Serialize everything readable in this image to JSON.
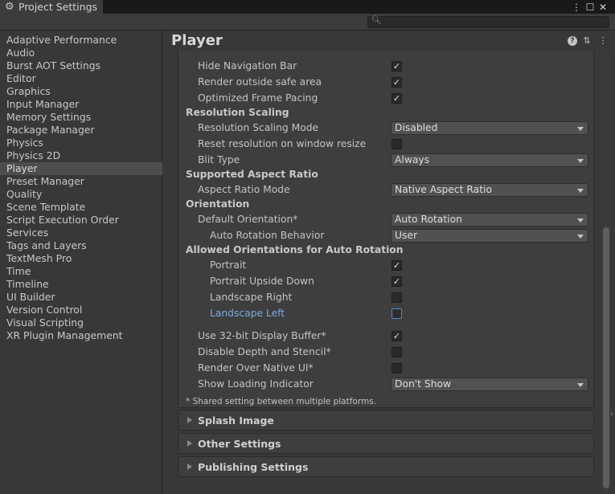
{
  "window": {
    "tab_title": "Project Settings",
    "controls": [
      "⋮",
      "☐",
      "✕"
    ]
  },
  "search": {
    "placeholder": "",
    "icon": "search-icon"
  },
  "sidebar": {
    "items": [
      {
        "label": "Adaptive Performance"
      },
      {
        "label": "Audio"
      },
      {
        "label": "Burst AOT Settings"
      },
      {
        "label": "Editor"
      },
      {
        "label": "Graphics"
      },
      {
        "label": "Input Manager"
      },
      {
        "label": "Memory Settings"
      },
      {
        "label": "Package Manager"
      },
      {
        "label": "Physics"
      },
      {
        "label": "Physics 2D"
      },
      {
        "label": "Player",
        "selected": true
      },
      {
        "label": "Preset Manager"
      },
      {
        "label": "Quality"
      },
      {
        "label": "Scene Template"
      },
      {
        "label": "Script Execution Order"
      },
      {
        "label": "Services"
      },
      {
        "label": "Tags and Layers"
      },
      {
        "label": "TextMesh Pro"
      },
      {
        "label": "Time"
      },
      {
        "label": "Timeline"
      },
      {
        "label": "UI Builder"
      },
      {
        "label": "Version Control"
      },
      {
        "label": "Visual Scripting"
      },
      {
        "label": "XR Plugin Management"
      }
    ]
  },
  "main": {
    "title": "Player",
    "header_icons": [
      "help-icon",
      "sliders-icon",
      "more-icon"
    ],
    "rows": [
      {
        "type": "checkbox",
        "label": "Hide Navigation Bar",
        "checked": true
      },
      {
        "type": "checkbox",
        "label": "Render outside safe area",
        "checked": true
      },
      {
        "type": "checkbox",
        "label": "Optimized Frame Pacing",
        "checked": true
      },
      {
        "type": "section",
        "label": "Resolution Scaling"
      },
      {
        "type": "dropdown",
        "label": "Resolution Scaling Mode",
        "value": "Disabled"
      },
      {
        "type": "checkbox",
        "label": "Reset resolution on window resize",
        "checked": false
      },
      {
        "type": "dropdown",
        "label": "Blit Type",
        "value": "Always"
      },
      {
        "type": "section",
        "label": "Supported Aspect Ratio"
      },
      {
        "type": "dropdown",
        "label": "Aspect Ratio Mode",
        "value": "Native Aspect Ratio"
      },
      {
        "type": "section",
        "label": "Orientation"
      },
      {
        "type": "dropdown",
        "label": "Default Orientation*",
        "value": "Auto Rotation"
      },
      {
        "type": "dropdown",
        "label": "Auto Rotation Behavior",
        "value": "User",
        "indent": 2
      },
      {
        "type": "section",
        "label": "Allowed Orientations for Auto Rotation"
      },
      {
        "type": "checkbox",
        "label": "Portrait",
        "checked": true,
        "indent": 2
      },
      {
        "type": "checkbox",
        "label": "Portrait Upside Down",
        "checked": true,
        "indent": 2
      },
      {
        "type": "checkbox",
        "label": "Landscape Right",
        "checked": false,
        "indent": 2
      },
      {
        "type": "checkbox",
        "label": "Landscape Left",
        "checked": false,
        "indent": 2,
        "focused": true
      },
      {
        "type": "checkbox",
        "label": "Use 32-bit Display Buffer*",
        "checked": true
      },
      {
        "type": "checkbox",
        "label": "Disable Depth and Stencil*",
        "checked": false
      },
      {
        "type": "checkbox",
        "label": "Render Over Native UI*",
        "checked": false
      },
      {
        "type": "dropdown",
        "label": "Show Loading Indicator",
        "value": "Don't Show"
      }
    ],
    "footnote": "* Shared setting between multiple platforms.",
    "foldouts": [
      {
        "label": "Splash Image"
      },
      {
        "label": "Other Settings"
      },
      {
        "label": "Publishing Settings"
      }
    ]
  },
  "colors": {
    "background": "#383838",
    "panel": "#3e3e3e",
    "selected": "#4d4d4d",
    "focus_text": "#7ea9e0",
    "focus_border": "#4d88d8"
  }
}
